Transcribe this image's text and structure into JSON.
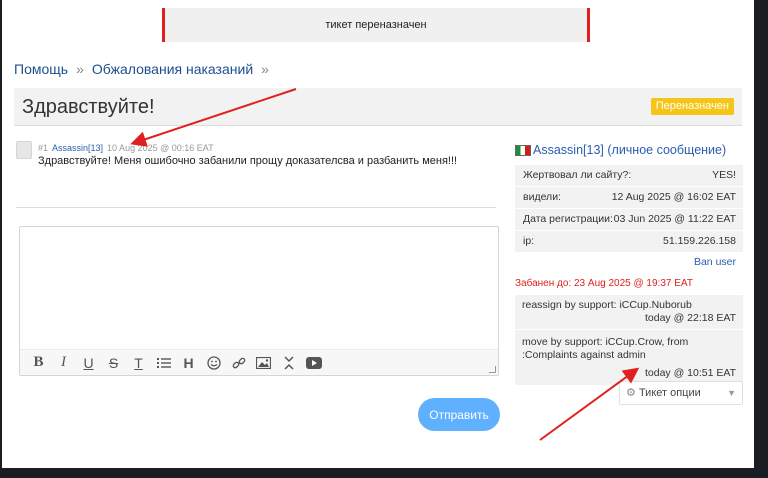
{
  "notice": "тикет переназначен",
  "breadcrumb": [
    "Помощь",
    "Обжалования наказаний"
  ],
  "breadcrumb_sep": "»",
  "ticket": {
    "title": "Здравствуйте!",
    "status": "Переназначен"
  },
  "post": {
    "number": "#1",
    "author": "Assassin[13]",
    "date": "10 Aug 2025 @ 00:16 EAT",
    "text": "Здравствуйте! Меня ошибочно забанили прощу доказателсва и разбанить меня!!!"
  },
  "toolbar": [
    "B",
    "I",
    "U",
    "S",
    "T",
    "list",
    "H",
    "emoji",
    "link",
    "image",
    "code",
    "video"
  ],
  "send_label": "Отправить",
  "sidebar": {
    "user": "Assassin[13]",
    "pm_label": "(личное сообщение)",
    "rows": [
      {
        "k": "Жертвовал ли сайту?:",
        "v": "YES!"
      },
      {
        "k": "видели:",
        "v": "12 Aug 2025 @ 16:02 EAT"
      },
      {
        "k": "Дата регистрации:",
        "v": "03 Jun 2025 @ 11:22 EAT"
      },
      {
        "k": "ip:",
        "v": "51.159.226.158"
      }
    ],
    "ban_user": "Ban user",
    "banned_until": "Забанен до: 23 Aug 2025 @ 19:37 EAT",
    "log1": {
      "text": "reassign by support: iCCup.Nuborub",
      "time": "today @ 22:18 EAT"
    },
    "log2": {
      "text": "move by support: iCCup.Crow, from :Complaints against admin",
      "time": "today @ 10:51 EAT"
    },
    "ticket_options": "Тикет опции"
  },
  "colors": {
    "accent": "#2a5db0",
    "badge": "#f5c518",
    "send": "#5fb0ff",
    "annotation": "#e02020"
  }
}
